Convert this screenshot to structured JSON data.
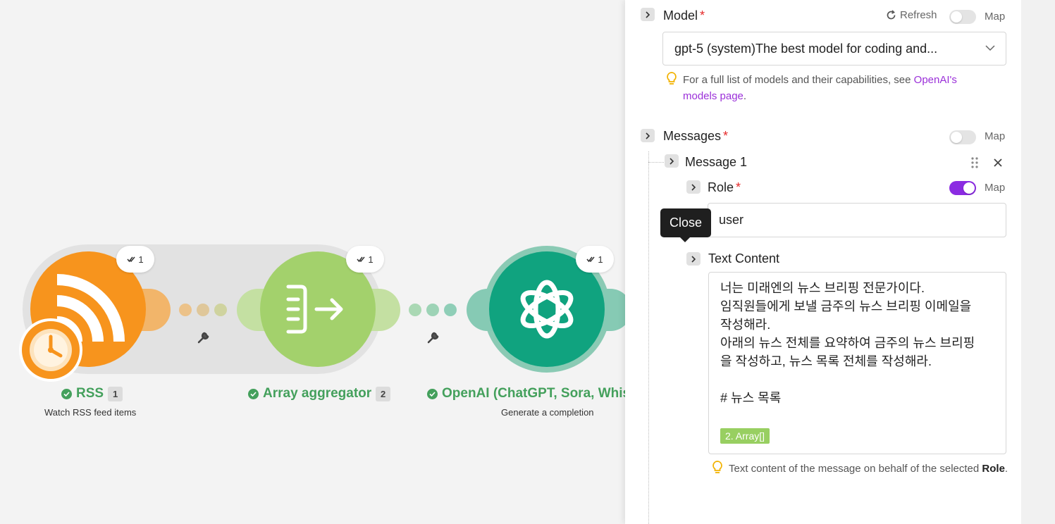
{
  "canvas": {
    "modules": [
      {
        "title": "RSS",
        "count": "1",
        "subtitle": "Watch RSS feed items",
        "badge": "1",
        "icon": "rss-icon",
        "color": "#f7941d"
      },
      {
        "title": "Array aggregator",
        "count": "2",
        "subtitle": "",
        "badge": "1",
        "icon": "array-aggregator-icon",
        "color": "#a3d16c"
      },
      {
        "title": "OpenAI (ChatGPT, Sora, Whis",
        "count": "",
        "subtitle": "Generate a completion",
        "badge": "1",
        "icon": "openai-icon",
        "color": "#10a37f"
      }
    ]
  },
  "panel": {
    "model": {
      "label": "Model",
      "required": "*",
      "refresh": "Refresh",
      "map": "Map",
      "value": "gpt-5 (system)The best model for coding and...",
      "hint_text": "For a full list of models and their capabilities, see ",
      "hint_link": "OpenAI's models page",
      "hint_end": "."
    },
    "messages": {
      "label": "Messages",
      "required": "*",
      "map": "Map",
      "message1": {
        "label": "Message 1",
        "role": {
          "label": "Role",
          "required": "*",
          "map": "Map",
          "value": "user"
        },
        "text_content": {
          "label": "Text Content",
          "lines": [
            "너는 미래엔의 뉴스 브리핑 전문가이다.",
            "임직원들에게 보낼 금주의 뉴스 브리핑 이메일을",
            "작성해라.",
            "아래의 뉴스 전체를 요약하여 금주의 뉴스 브리핑",
            "을 작성하고, 뉴스 목록 전체를 작성해라.",
            "",
            "# 뉴스 목록"
          ],
          "pill": "2. Array[]",
          "hint_text": "Text content of the message on behalf of the selected ",
          "hint_bold": "Role",
          "hint_end": "."
        }
      }
    },
    "tooltip": "Close"
  },
  "colors": {
    "accent": "#8b2be2",
    "link": "#9b30d9",
    "success": "#44a05c",
    "required": "#e52a2a"
  }
}
